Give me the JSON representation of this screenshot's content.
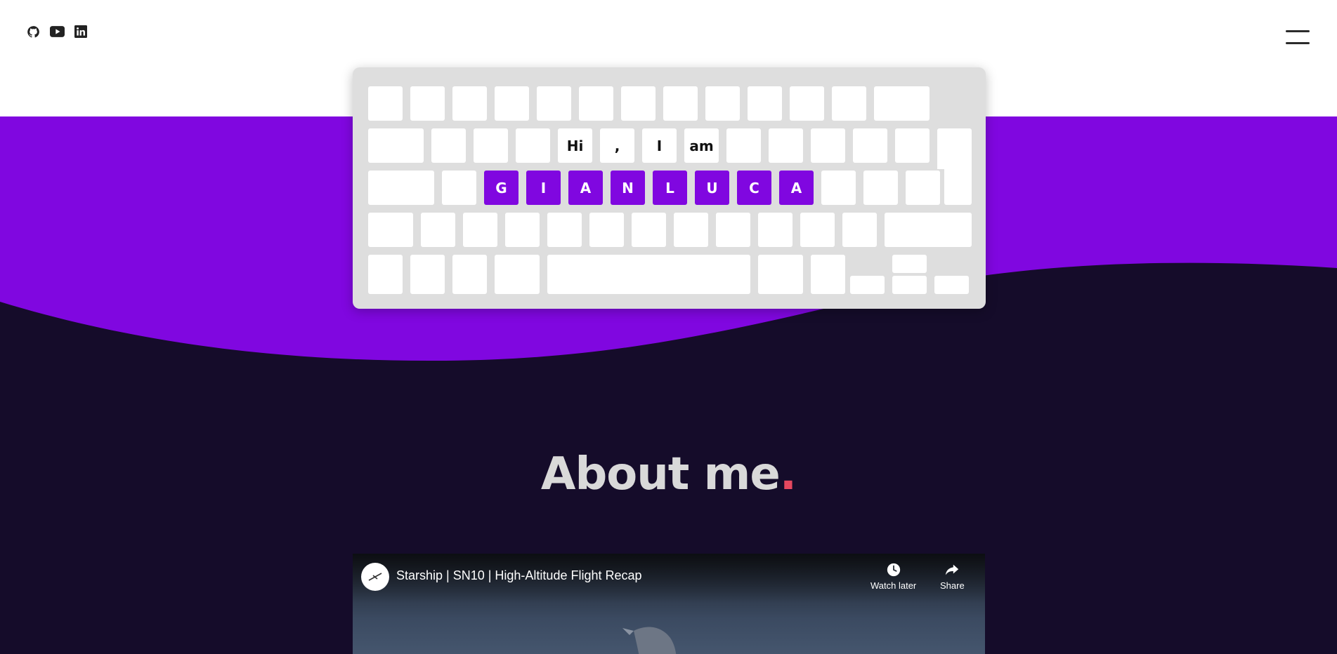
{
  "social": {
    "icons": [
      "github-icon",
      "youtube-icon",
      "linkedin-icon"
    ]
  },
  "menu": {
    "icon": "hamburger-menu-icon"
  },
  "colors": {
    "purple": "#8007e0",
    "dark": "#150c2a",
    "keyboard_bg": "#dedede",
    "key": "#ffffff",
    "accent_dot": "#e5485f",
    "title": "#d9d9d9"
  },
  "keyboard": {
    "greeting": [
      "Hi",
      ",",
      "I",
      "am"
    ],
    "name": [
      "G",
      "I",
      "A",
      "N",
      "L",
      "U",
      "C",
      "A"
    ]
  },
  "about": {
    "title": "About me",
    "dot": "."
  },
  "video": {
    "title": "Starship | SN10 | High-Altitude Flight Recap",
    "watch_later_label": "Watch later",
    "share_label": "Share"
  }
}
